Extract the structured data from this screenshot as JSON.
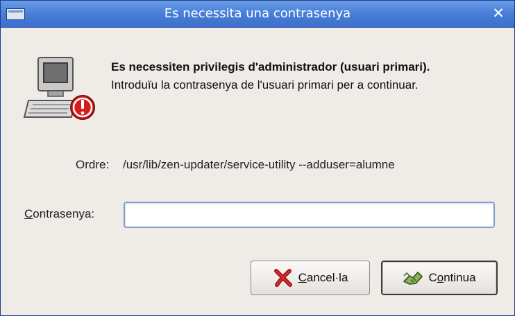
{
  "window": {
    "title": "Es necessita una contrasenya",
    "menu_icon": "window-menu-icon",
    "close_glyph": "✕"
  },
  "message": {
    "icon": "computer-warning-icon",
    "heading": "Es necessiten privilegis d'administrador (usuari primari).",
    "body": "Introduïu la contrasenya de l'usuari primari per a continuar."
  },
  "command": {
    "label": "Ordre:",
    "value": "/usr/lib/zen-updater/service-utility --adduser=alumne"
  },
  "password": {
    "label_mnemonic": "C",
    "label_rest": "ontrasenya:",
    "value": "",
    "placeholder": ""
  },
  "buttons": {
    "cancel": {
      "icon": "cross-icon",
      "mnemonic": "C",
      "rest": "ancel·la"
    },
    "continue": {
      "icon": "handshake-icon",
      "pre": "C",
      "mnemonic": "o",
      "rest": "ntinua"
    }
  },
  "colors": {
    "titlebar": "#4a80d9",
    "background": "#efebe7",
    "field_border": "#7e9ed4",
    "warning_red": "#d61e1e"
  }
}
